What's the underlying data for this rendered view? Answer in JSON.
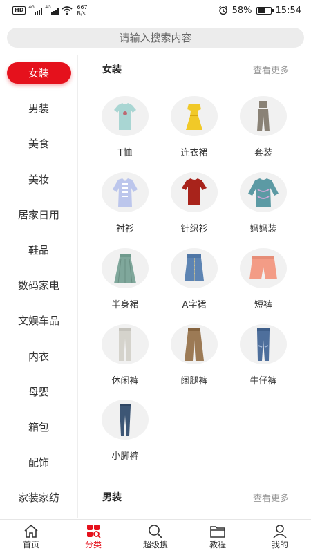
{
  "status_bar": {
    "left_badge": "HD",
    "signal1": "4G",
    "signal2": "4G",
    "net_speed_value": "667",
    "net_speed_unit": "B/s",
    "battery": "58%",
    "battery_level": 0.58,
    "time": "15:54"
  },
  "search": {
    "placeholder": "请输入搜索内容"
  },
  "sidebar": {
    "items": [
      {
        "label": "女装",
        "active": true
      },
      {
        "label": "男装"
      },
      {
        "label": "美食"
      },
      {
        "label": "美妆"
      },
      {
        "label": "居家日用"
      },
      {
        "label": "鞋品"
      },
      {
        "label": "数码家电"
      },
      {
        "label": "文娱车品"
      },
      {
        "label": "内衣"
      },
      {
        "label": "母婴"
      },
      {
        "label": "箱包"
      },
      {
        "label": "配饰"
      },
      {
        "label": "家装家纺"
      }
    ]
  },
  "sections": [
    {
      "title": "女装",
      "more": "查看更多",
      "items": [
        {
          "label": "T恤",
          "icon": "tshirt-icon",
          "color": "#a9d6d3"
        },
        {
          "label": "连衣裙",
          "icon": "dress-icon",
          "color": "#f1c928"
        },
        {
          "label": "套装",
          "icon": "set-icon",
          "color": "#8a8276"
        },
        {
          "label": "衬衫",
          "icon": "shirt-icon",
          "color": "#bcc6ec"
        },
        {
          "label": "针织衫",
          "icon": "knit-icon",
          "color": "#a8231b"
        },
        {
          "label": "妈妈装",
          "icon": "mom-wear-icon",
          "color": "#5c9aa4"
        },
        {
          "label": "半身裙",
          "icon": "skirt-icon",
          "color": "#7fa79b"
        },
        {
          "label": "A字裙",
          "icon": "denim-skirt-icon",
          "color": "#5d84b3"
        },
        {
          "label": "短裤",
          "icon": "shorts-icon",
          "color": "#f39c86"
        },
        {
          "label": "休闲裤",
          "icon": "casual-pants-icon",
          "color": "#d5d3cc"
        },
        {
          "label": "阔腿裤",
          "icon": "wide-pants-icon",
          "color": "#9c7a55"
        },
        {
          "label": "牛仔裤",
          "icon": "jeans-icon",
          "color": "#4e6f9c"
        },
        {
          "label": "小脚裤",
          "icon": "skinny-pants-icon",
          "color": "#3d5675"
        }
      ]
    },
    {
      "title": "男装",
      "more": "查看更多"
    }
  ],
  "bottom_nav": [
    {
      "label": "首页",
      "icon": "home-icon"
    },
    {
      "label": "分类",
      "icon": "category-icon",
      "active": true
    },
    {
      "label": "超级搜",
      "icon": "search-icon"
    },
    {
      "label": "教程",
      "icon": "folder-icon"
    },
    {
      "label": "我的",
      "icon": "user-icon"
    }
  ],
  "colors": {
    "accent": "#e5111c"
  }
}
